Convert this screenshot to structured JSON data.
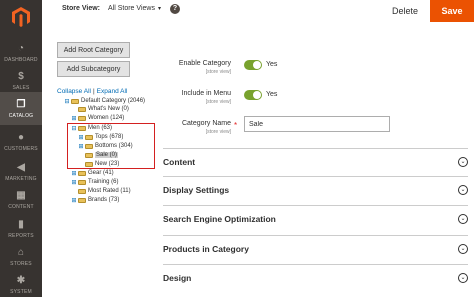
{
  "sidebar": {
    "items": [
      {
        "label": "Dashboard",
        "icon": "dashboard-icon",
        "glyph": "◔",
        "active": false
      },
      {
        "label": "Sales",
        "icon": "dollar-icon",
        "glyph": "$",
        "active": false
      },
      {
        "label": "Catalog",
        "icon": "box-icon",
        "glyph": "❒",
        "active": true
      },
      {
        "label": "Customers",
        "icon": "person-icon",
        "glyph": "●",
        "active": false
      },
      {
        "label": "Marketing",
        "icon": "megaphone-icon",
        "glyph": "◀",
        "active": false
      },
      {
        "label": "Content",
        "icon": "content-icon",
        "glyph": "▦",
        "active": false
      },
      {
        "label": "Reports",
        "icon": "bar-chart-icon",
        "glyph": "▮",
        "active": false
      },
      {
        "label": "Stores",
        "icon": "store-icon",
        "glyph": "⌂",
        "active": false
      },
      {
        "label": "System",
        "icon": "gear-icon",
        "glyph": "✱",
        "active": false
      }
    ]
  },
  "toolbar": {
    "store_view_label": "Store View:",
    "store_view_value": "All Store Views",
    "help_glyph": "?",
    "delete_label": "Delete",
    "save_label": "Save"
  },
  "left": {
    "add_root_label": "Add Root Category",
    "add_sub_label": "Add Subcategory",
    "collapse_label": "Collapse All",
    "separator": "|",
    "expand_label": "Expand All",
    "tree": [
      {
        "label": "Default Category (2046)",
        "expander": "⊟"
      },
      {
        "label": "What's New (0)",
        "expander": ""
      },
      {
        "label": "Women (124)",
        "expander": "⊞"
      },
      {
        "label": "Men (63)",
        "expander": "⊟"
      },
      {
        "label": "Tops (678)",
        "expander": "⊞"
      },
      {
        "label": "Bottoms (304)",
        "expander": "⊞"
      },
      {
        "label": "Sale (0)",
        "expander": "",
        "selected": true
      },
      {
        "label": "New (23)",
        "expander": ""
      },
      {
        "label": "Gear (41)",
        "expander": "⊞"
      },
      {
        "label": "Training (6)",
        "expander": "⊞"
      },
      {
        "label": "Most Rated (11)",
        "expander": ""
      },
      {
        "label": "Brands (73)",
        "expander": "⊞"
      }
    ]
  },
  "form": {
    "enable_label": "Enable Category",
    "enable_scope": "[store view]",
    "enable_value": "Yes",
    "menu_label": "Include in Menu",
    "menu_scope": "[store view]",
    "menu_value": "Yes",
    "name_label": "Category Name",
    "name_scope": "[store view]",
    "required_mark": "*",
    "name_value": "Sale"
  },
  "sections": [
    {
      "title": "Content"
    },
    {
      "title": "Display Settings"
    },
    {
      "title": "Search Engine Optimization"
    },
    {
      "title": "Products in Category"
    },
    {
      "title": "Design"
    }
  ],
  "colors": {
    "sidebar_bg": "#373330",
    "accent": "#eb5202",
    "toggle_on": "#79a22e",
    "link": "#006bb4",
    "highlight": "#d32020"
  }
}
